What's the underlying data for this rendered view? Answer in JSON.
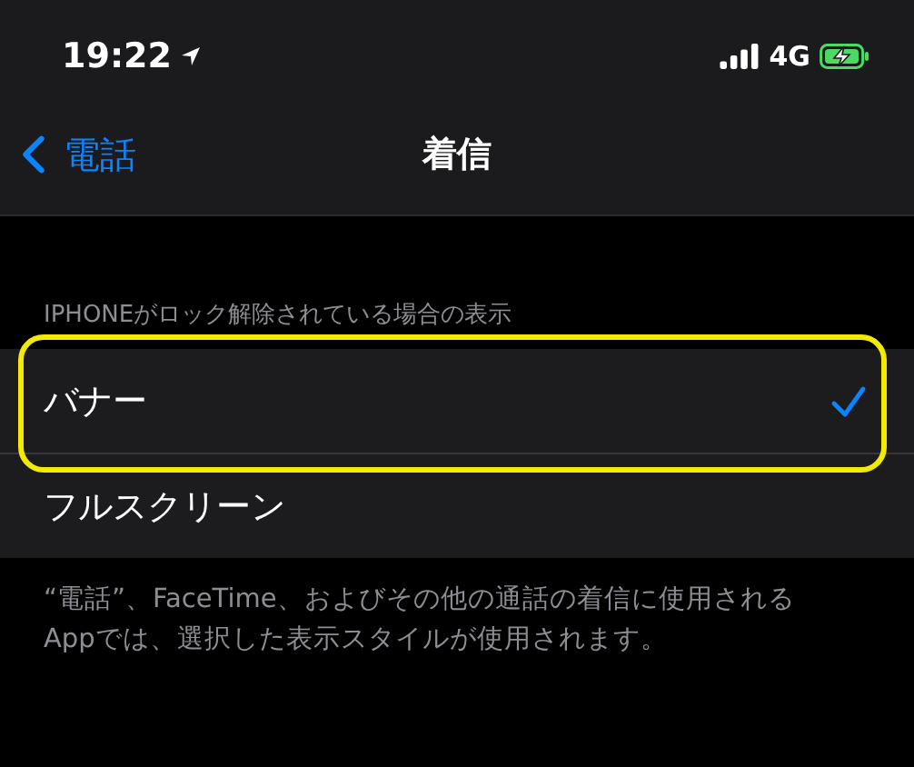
{
  "status_bar": {
    "time": "19:22",
    "network": "4G"
  },
  "nav": {
    "back_label": "電話",
    "title": "着信"
  },
  "section": {
    "header": "IPHONEがロック解除されている場合の表示",
    "options": [
      {
        "label": "バナー",
        "selected": true
      },
      {
        "label": "フルスクリーン",
        "selected": false
      }
    ],
    "footer": "“電話”、FaceTime、およびその他の通話の着信に使用されるAppでは、選択した表示スタイルが使用されます。"
  }
}
